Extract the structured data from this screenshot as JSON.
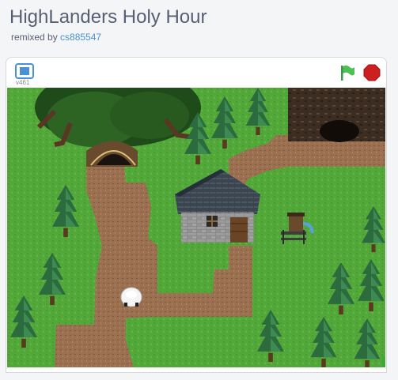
{
  "project": {
    "title": "HighLanders Holy Hour",
    "remixed_by_prefix": "remixed by",
    "author": "cs885547"
  },
  "player": {
    "version": "v461",
    "fullscreen_icon": "fullscreen-icon",
    "green_flag_icon": "green-flag-icon",
    "stop_icon": "stop-icon"
  },
  "colors": {
    "accent_link": "#4a90d6",
    "flag_green": "#4cbf56",
    "stop_red": "#cc2020",
    "grass": "#53a83a",
    "path": "#9a7050"
  }
}
